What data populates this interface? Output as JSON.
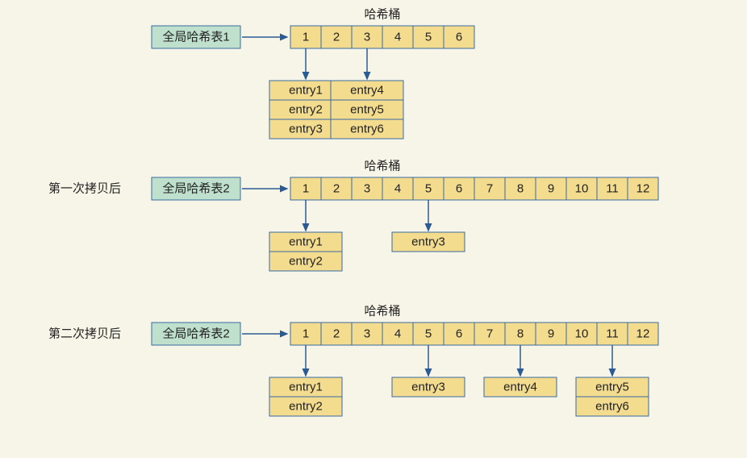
{
  "sections": [
    {
      "id": "sec1",
      "prefix": "",
      "label": "全局哈希表1",
      "header": "哈希桶",
      "bucketCount": 6,
      "buckets": [
        "1",
        "2",
        "3",
        "4",
        "5",
        "6"
      ],
      "chains": [
        {
          "bucket": 1,
          "entries": [
            "entry1",
            "entry2",
            "entry3"
          ]
        },
        {
          "bucket": 3,
          "entries": [
            "entry4",
            "entry5",
            "entry6"
          ]
        }
      ]
    },
    {
      "id": "sec2",
      "prefix": "第一次拷贝后",
      "label": "全局哈希表2",
      "header": "哈希桶",
      "bucketCount": 12,
      "buckets": [
        "1",
        "2",
        "3",
        "4",
        "5",
        "6",
        "7",
        "8",
        "9",
        "10",
        "11",
        "12"
      ],
      "chains": [
        {
          "bucket": 1,
          "entries": [
            "entry1",
            "entry2"
          ]
        },
        {
          "bucket": 5,
          "entries": [
            "entry3"
          ]
        }
      ]
    },
    {
      "id": "sec3",
      "prefix": "第二次拷贝后",
      "label": "全局哈希表2",
      "header": "哈希桶",
      "bucketCount": 12,
      "buckets": [
        "1",
        "2",
        "3",
        "4",
        "5",
        "6",
        "7",
        "8",
        "9",
        "10",
        "11",
        "12"
      ],
      "chains": [
        {
          "bucket": 1,
          "entries": [
            "entry1",
            "entry2"
          ]
        },
        {
          "bucket": 5,
          "entries": [
            "entry3"
          ]
        },
        {
          "bucket": 8,
          "entries": [
            "entry4"
          ]
        },
        {
          "bucket": 11,
          "entries": [
            "entry5",
            "entry6"
          ]
        }
      ]
    }
  ],
  "layout": {
    "bucketCellW": 38,
    "bucketCellH": 28,
    "entryCellW": 90,
    "entryCellH": 24,
    "labelBoxW": 110,
    "labelBoxH": 28,
    "bucketStartX": 360,
    "sectionYs": [
      32,
      220,
      400
    ],
    "arrowGap": 34,
    "chainDrop": 40
  }
}
